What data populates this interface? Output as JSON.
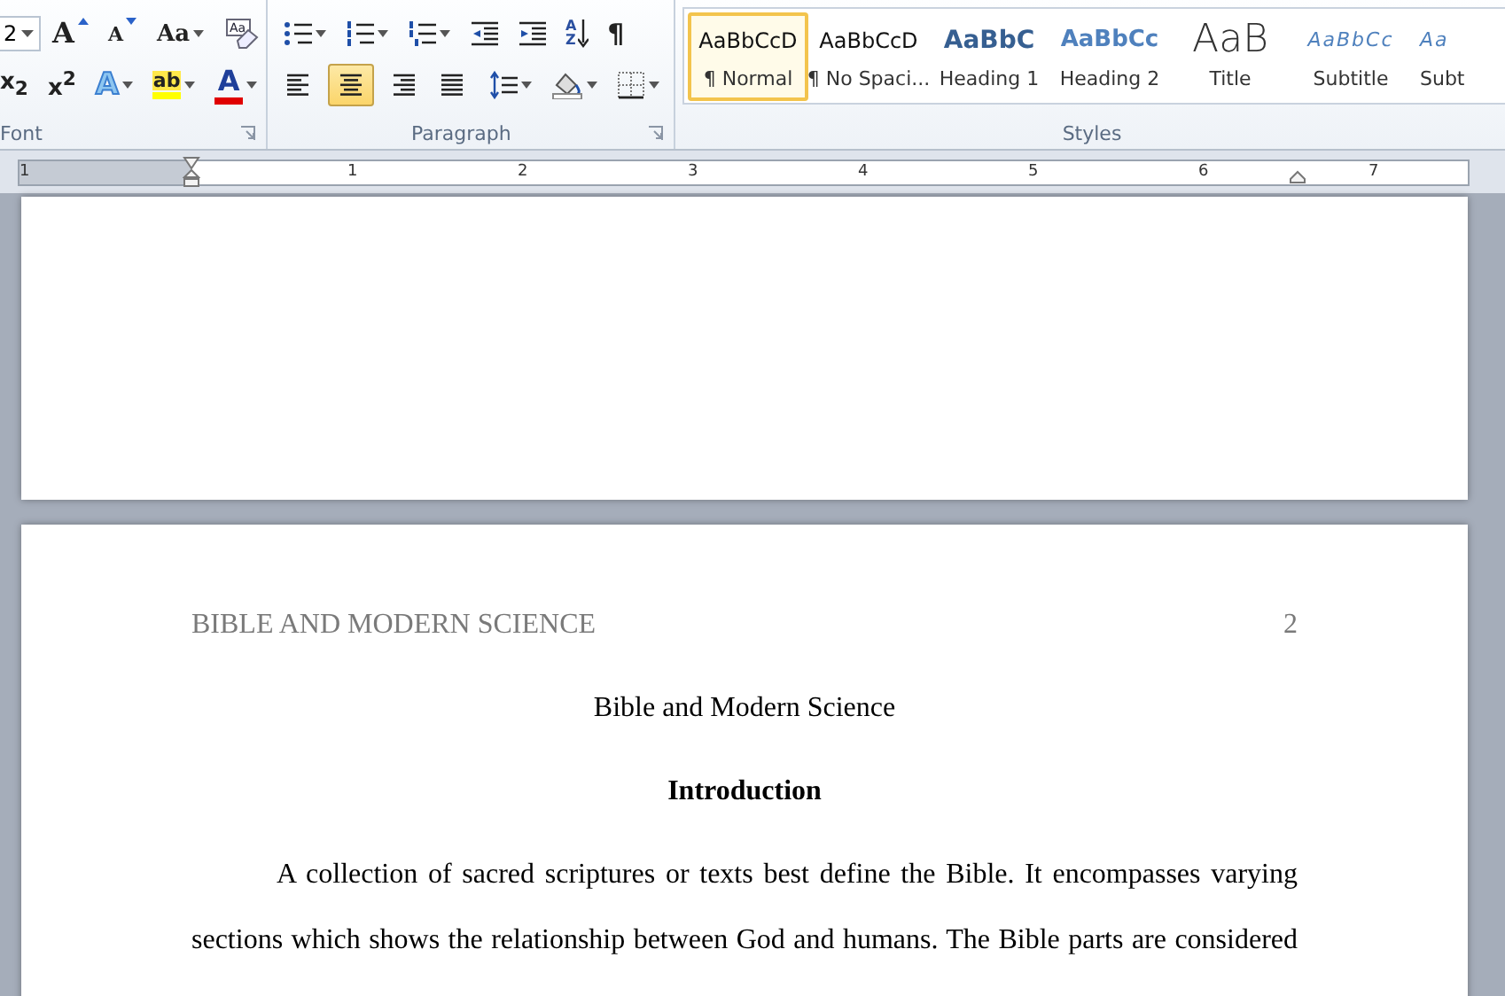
{
  "ribbon": {
    "font": {
      "label": "Font",
      "size_value": "2",
      "row1": [
        {
          "kind": "grow",
          "glyph": "A"
        },
        {
          "kind": "shrink",
          "glyph": "A"
        },
        {
          "kind": "case",
          "glyph": "Aa"
        },
        {
          "kind": "clear",
          "glyph": "Aa"
        }
      ],
      "row2": [
        {
          "kind": "sub",
          "glyph": "x$_{2}$"
        },
        {
          "kind": "sup",
          "glyph": "x$^{2}$"
        },
        {
          "kind": "effects",
          "glyph": "A"
        },
        {
          "kind": "highlight",
          "glyph": "ab"
        },
        {
          "kind": "color",
          "glyph": "A"
        }
      ]
    },
    "paragraph": {
      "label": "Paragraph",
      "row1": [
        {
          "kind": "bullets"
        },
        {
          "kind": "numbering"
        },
        {
          "kind": "multilevel"
        },
        {
          "kind": "outdent"
        },
        {
          "kind": "indent"
        },
        {
          "kind": "sort",
          "glyph": "AZ"
        },
        {
          "kind": "marks",
          "glyph": "¶"
        }
      ],
      "align": [
        {
          "kind": "left",
          "selected": false
        },
        {
          "kind": "center",
          "selected": true
        },
        {
          "kind": "right",
          "selected": false
        },
        {
          "kind": "justify",
          "selected": false
        }
      ],
      "row2": [
        {
          "kind": "spacing"
        },
        {
          "kind": "shading"
        },
        {
          "kind": "borders"
        }
      ]
    },
    "styles": {
      "label": "Styles",
      "items": [
        {
          "kind": "normal",
          "preview": "AaBbCcD",
          "name": "¶ Normal",
          "selected": true
        },
        {
          "kind": "normal",
          "preview": "AaBbCcD",
          "name": "¶ No Spaci...",
          "selected": false
        },
        {
          "kind": "heading1",
          "preview": "AaBbC",
          "name": "Heading 1",
          "selected": false
        },
        {
          "kind": "heading2",
          "preview": "AaBbCc",
          "name": "Heading 2",
          "selected": false
        },
        {
          "kind": "title",
          "preview": "AaB",
          "name": "Title",
          "selected": false
        },
        {
          "kind": "subtitle",
          "preview": "AaBbCc",
          "name": "Subtitle",
          "selected": false
        },
        {
          "kind": "subtitle",
          "preview": "Aa",
          "name": "Subt",
          "selected": false
        }
      ]
    }
  },
  "ruler": {
    "numbers": [
      "1",
      "1",
      "2",
      "3",
      "4",
      "5",
      "6",
      "7"
    ]
  },
  "document": {
    "header": "BIBLE AND MODERN SCIENCE",
    "page_number": "2",
    "title": "Bible and Modern Science",
    "heading": "Introduction",
    "paragraph": "A collection of sacred scriptures or texts best define the Bible. It encompasses varying sections which shows the relationship between God and humans. The Bible parts are considered"
  }
}
